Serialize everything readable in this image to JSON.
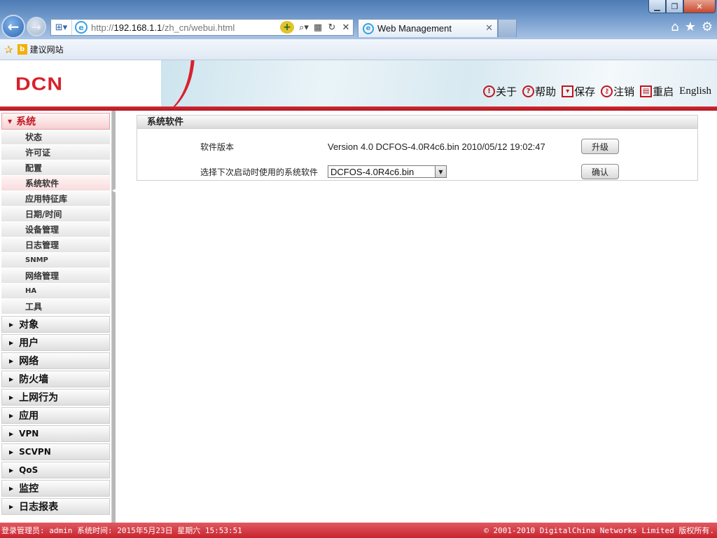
{
  "browser": {
    "url_prefix": "http://",
    "url_host": "192.168.1.1",
    "url_path": "/zh_cn/webui.html",
    "tab_title": "Web Management",
    "favorites": [
      {
        "label": "建议网站"
      }
    ]
  },
  "header": {
    "logo": "DCN",
    "links": [
      {
        "label": "关于",
        "icon": "info-icon"
      },
      {
        "label": "帮助",
        "icon": "help-icon"
      },
      {
        "label": "保存",
        "icon": "save-icon"
      },
      {
        "label": "注销",
        "icon": "logout-key-icon"
      },
      {
        "label": "重启",
        "icon": "restart-icon"
      }
    ],
    "language": "English",
    "accent_color": "#c8242e"
  },
  "sidebar": {
    "open_section": "系统",
    "sub_items": [
      {
        "label": "状态"
      },
      {
        "label": "许可证"
      },
      {
        "label": "配置"
      },
      {
        "label": "系统软件",
        "active": true
      },
      {
        "label": "应用特征库"
      },
      {
        "label": "日期/时间"
      },
      {
        "label": "设备管理"
      },
      {
        "label": "日志管理"
      },
      {
        "label": "SNMP"
      },
      {
        "label": "网络管理"
      },
      {
        "label": "HA"
      },
      {
        "label": "工具"
      }
    ],
    "sections": [
      {
        "label": "对象"
      },
      {
        "label": "用户"
      },
      {
        "label": "网络"
      },
      {
        "label": "防火墙"
      },
      {
        "label": "上网行为"
      },
      {
        "label": "应用"
      },
      {
        "label": "VPN"
      },
      {
        "label": "SCVPN"
      },
      {
        "label": "QoS"
      },
      {
        "label": "监控"
      },
      {
        "label": "日志报表"
      }
    ]
  },
  "panel": {
    "title": "系统软件",
    "version_label": "软件版本",
    "version_value": "Version 4.0 DCFOS-4.0R4c6.bin 2010/05/12 19:02:47",
    "upgrade_button": "升级",
    "boot_label": "选择下次启动时使用的系统软件",
    "boot_selected": "DCFOS-4.0R4c6.bin",
    "confirm_button": "确认"
  },
  "status_bar": {
    "left": "登录管理员: admin 系统时间: 2015年5月23日 星期六 15:53:51",
    "right": "© 2001-2010 DigitalChina Networks Limited 版权所有."
  }
}
